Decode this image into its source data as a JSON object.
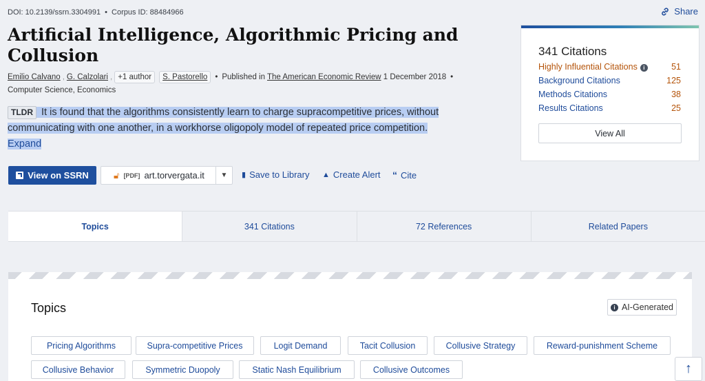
{
  "meta": {
    "doi": "DOI: 10.2139/ssrn.3304991",
    "corpus": "Corpus ID: 88484966"
  },
  "share": {
    "label": "Share",
    "icon": "link-icon"
  },
  "paper": {
    "title": "Artificial Intelligence, Algorithmic Pricing and Collusion",
    "authors": [
      "Emilio Calvano",
      "G. Calzolari"
    ],
    "more_authors": "+1 author",
    "last_author": "S. Pastorello",
    "published_in_prefix": "Published in",
    "venue": "The American Economic Review",
    "date": "1 December 2018",
    "fields": "Computer Science, Economics"
  },
  "tldr": {
    "badge": "TLDR",
    "text": "It is found that the algorithms consistently learn to charge supracompetitive prices, without communicating with one another, in a workhorse oligopoly model of repeated price competition.",
    "expand": "Expand"
  },
  "actions": {
    "view_primary": "View on SSRN",
    "pdf_tag": "[PDF]",
    "pdf_source": "art.torvergata.it",
    "save": "Save to Library",
    "alert": "Create Alert",
    "cite": "Cite"
  },
  "citations_card": {
    "heading": "341 Citations",
    "rows": [
      {
        "label": "Highly Influential Citations",
        "value": "51"
      },
      {
        "label": "Background Citations",
        "value": "125"
      },
      {
        "label": "Methods Citations",
        "value": "38"
      },
      {
        "label": "Results Citations",
        "value": "25"
      }
    ],
    "view_all": "View All"
  },
  "tabs": [
    "Topics",
    "341 Citations",
    "72 References",
    "Related Papers"
  ],
  "topics": {
    "heading": "Topics",
    "ai_badge": "AI-Generated",
    "chips": [
      "Pricing Algorithms",
      "Supra-competitive Prices",
      "Logit Demand",
      "Tacit Collusion",
      "Collusive Strategy",
      "Reward-punishment Scheme",
      "Collusive Behavior",
      "Symmetric Duopoly",
      "Static Nash Equilibrium",
      "Collusive Outcomes"
    ]
  },
  "colors": {
    "accent": "#1e4b9a",
    "primary_button": "#1e4f9e",
    "highlight": "#b8cdf2",
    "count": "#b45309"
  }
}
